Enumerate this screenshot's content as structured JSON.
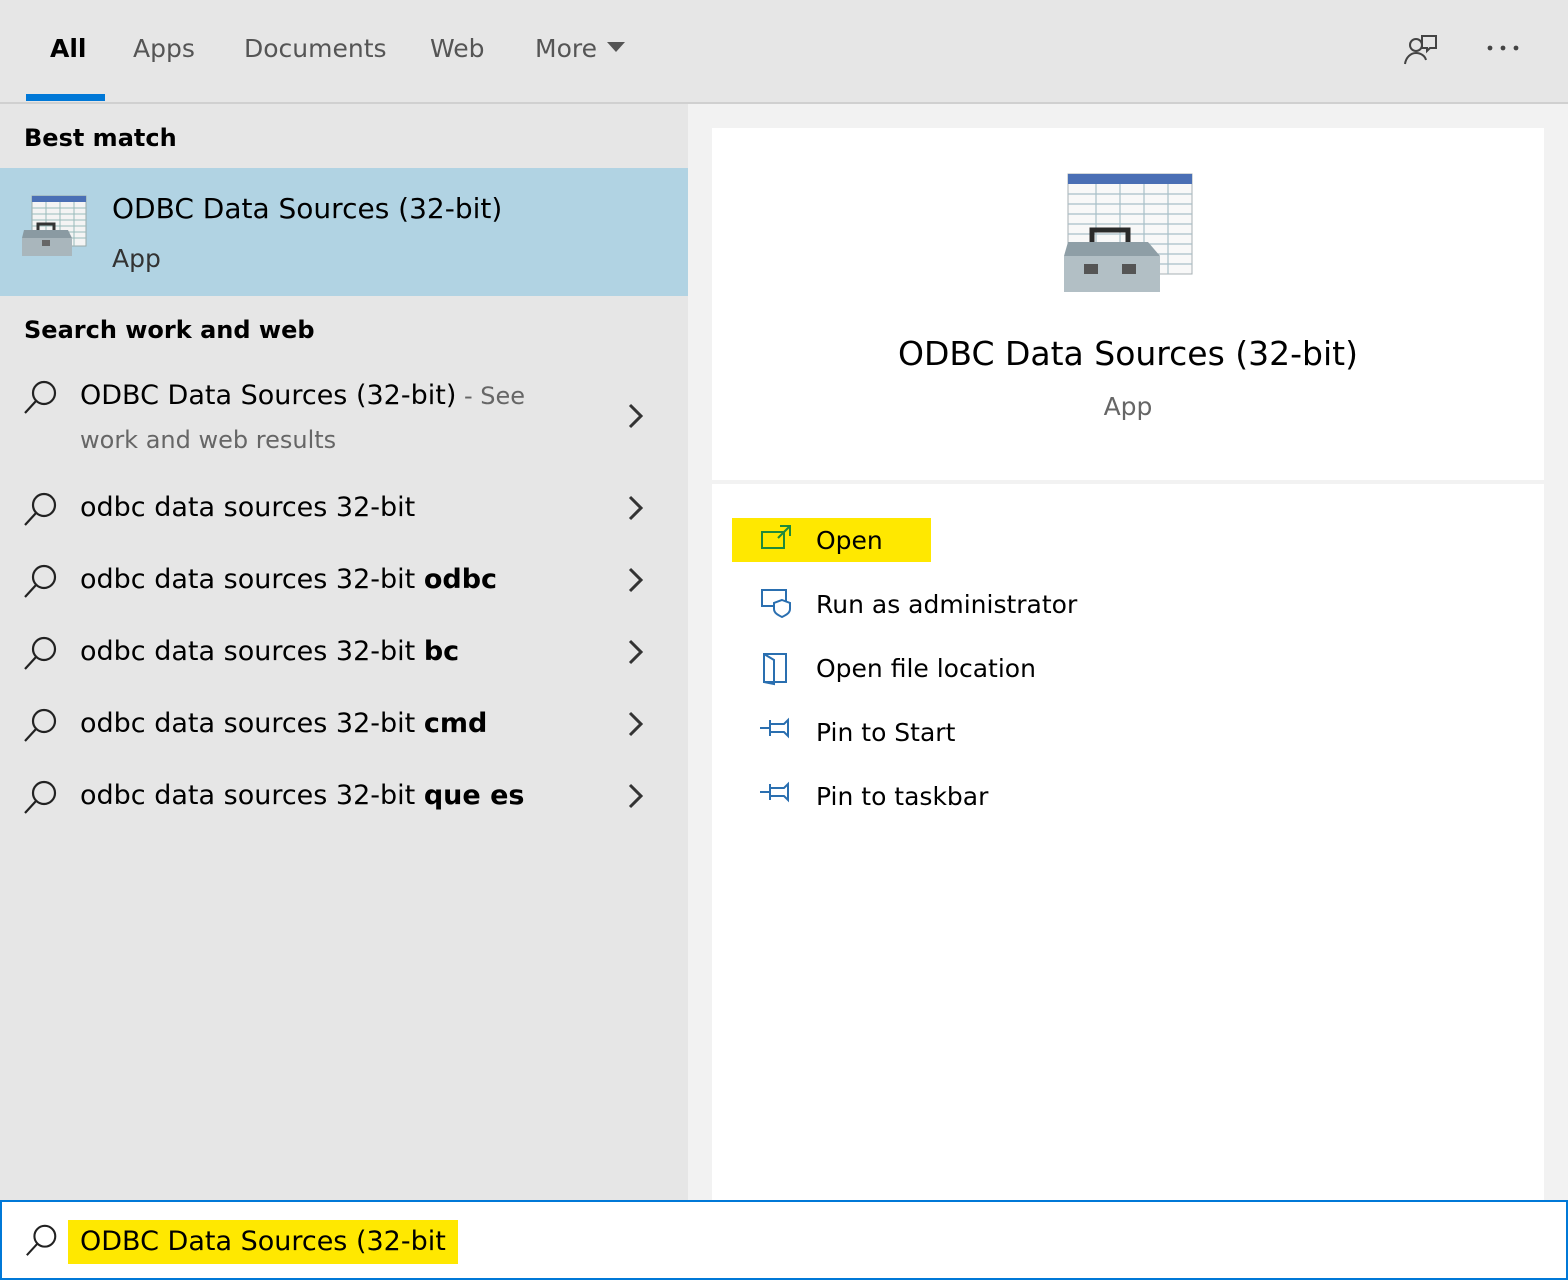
{
  "tabs": [
    {
      "label": "All",
      "active": true
    },
    {
      "label": "Apps",
      "active": false
    },
    {
      "label": "Documents",
      "active": false
    },
    {
      "label": "Web",
      "active": false
    },
    {
      "label": "More",
      "active": false
    }
  ],
  "top_icons": [
    "feedback-icon",
    "more-options-icon"
  ],
  "left": {
    "best_match_heading": "Best match",
    "best_match": {
      "title": "ODBC Data Sources (32-bit)",
      "subtitle": "App",
      "icon": "odbc-toolbox-icon"
    },
    "search_web_heading": "Search work and web",
    "results": [
      {
        "main": "ODBC Data Sources (32-bit)",
        "suffix": " - See",
        "line2": "work and web results",
        "bold": ""
      },
      {
        "main": "odbc data sources 32-bit",
        "bold": ""
      },
      {
        "main": "odbc data sources 32-bit ",
        "bold": "odbc"
      },
      {
        "main": "odbc data sources 32-bit ",
        "bold": "bc"
      },
      {
        "main": "odbc data sources 32-bit ",
        "bold": "cmd"
      },
      {
        "main": "odbc data sources 32-bit ",
        "bold": "que es"
      }
    ]
  },
  "preview": {
    "title": "ODBC Data Sources (32-bit)",
    "subtitle": "App",
    "actions": [
      {
        "label": "Open",
        "icon": "open-icon"
      },
      {
        "label": "Run as administrator",
        "icon": "run-as-admin-icon"
      },
      {
        "label": "Open file location",
        "icon": "file-location-icon"
      },
      {
        "label": "Pin to Start",
        "icon": "pin-icon"
      },
      {
        "label": "Pin to taskbar",
        "icon": "pin-icon"
      }
    ]
  },
  "search": {
    "value": "ODBC Data Sources (32-bit)"
  },
  "colors": {
    "accent": "#0078d7",
    "selection": "#b1d3e3",
    "highlight": "#ffe800"
  }
}
